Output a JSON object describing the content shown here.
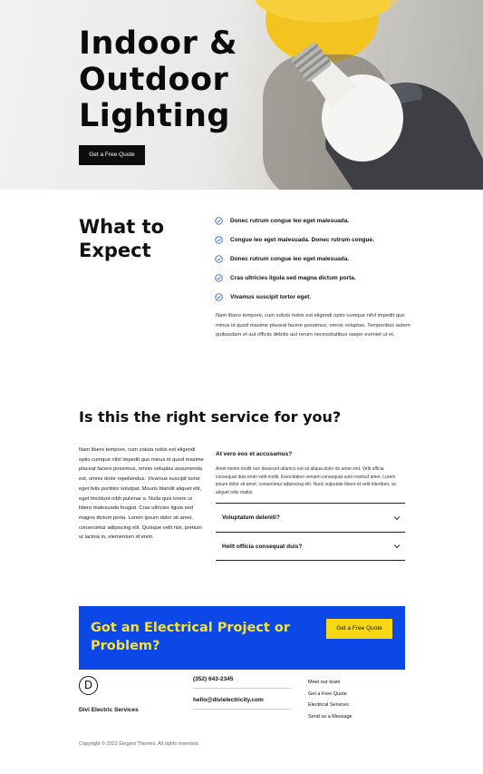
{
  "hero": {
    "title_line1": "Indoor &",
    "title_line2": "Outdoor",
    "title_line3": "Lighting",
    "button_label": "Get a Free Quote"
  },
  "expect": {
    "title_line1": "What to",
    "title_line2": "Expect",
    "items": [
      "Donec rutrum congue leo eget malesuada.",
      "Congue leo eget malesuada. Donec rutrum congue.",
      "Donec rutrum congue leo eget malesuada.",
      "Cras ultricies ligula sed magna dictum porta.",
      "Vivamus suscipit tortor eget."
    ],
    "paragraph": "Nam libero tempore, cum soluta nobis est eligendi optio cumque nihil impedit quo minus id quod maxime placeat facere possimus, omnis voluptas. Temporibus autem quibusdam et aut officiis debitis aut rerum necessitatibus saepe eveniet ut et."
  },
  "service": {
    "title": "Is this the right service for you?",
    "paragraph": "Nam libero tempore, cum soluta nobis est eligendi optio cumque nihil impedit quo minus id quod maxime placeat facere possimus, omnis voluptas assumenda est, omnis dolor repellendus. Vivamus suscipit tortor eget felis porttitor volutpat. Mauris blandit aliquet elit, eget tincidunt nibh pulvinar a. Nulla quis lorem ut libero malesuada feugiat. Cras ultricies ligula sed magna dictum porta. Lorem ipsum dolor sit amet, consectetur adipiscing elit. Quisque velit nisi, pretium ut lacinia in, elementum id enim.",
    "accordion": {
      "open_title": "At vero eos et accusamus?",
      "open_text": "Amet minim mollit non deserunt ullamco est sit aliqua dolor do amet sint. Velit officia consequat duis enim velit mollit. Exercitation veniam consequat sunt nostrud amet. Lorem ipsum dolor sit amet, consectetur adipiscing elit. Nunc vulputate libero et velit interdum, ac aliquet odio mattis.",
      "item2": "Voluptatum deleniti?",
      "item3": "Hellt officia consequat duis?"
    }
  },
  "cta": {
    "title": "Got an Electrical Project or Problem?",
    "button_label": "Get a Free Quote"
  },
  "footer": {
    "logo_letter": "D",
    "brand": "Divi Electric Services",
    "phone": "(352) 643-2345",
    "email": "hello@divielectricity.com",
    "links": [
      "Meet our team",
      "Get a Free Quote",
      "Electrical Services",
      "Send us a Message"
    ],
    "copyright": "Copyright © 2022 Elegant Themes. All rights reserved."
  },
  "colors": {
    "cta_background": "#0c47e8",
    "cta_title": "#f7e234",
    "cta_button": "#f7d815",
    "check_icon": "#2c5fd6"
  }
}
